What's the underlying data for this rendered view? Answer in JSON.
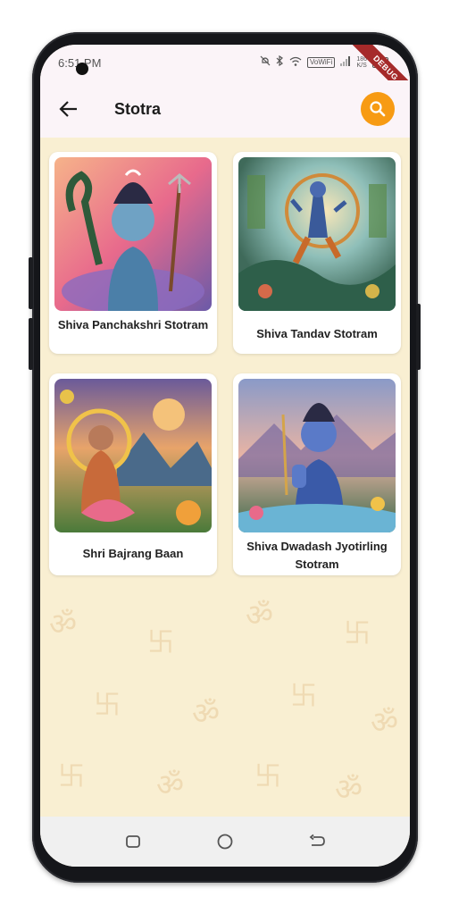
{
  "status_bar": {
    "time": "6:51 PM",
    "network_label": "VoWiFi",
    "speed": "186\nK/S",
    "debug_banner": "DEBUG"
  },
  "app_bar": {
    "back_icon": "arrow-left-icon",
    "title": "Stotra",
    "search_icon": "search-icon",
    "accent": "#f79b13"
  },
  "stotras": [
    {
      "title": "Shiva Panchakshri Stotram",
      "image": "shiva-with-trident-and-cobra"
    },
    {
      "title": "Shiva Tandav Stotram",
      "image": "nataraja-dancing-shiva"
    },
    {
      "title": "Shri Bajrang Baan",
      "image": "hanuman-seated-on-lotus"
    },
    {
      "title": "Shiva Dwadash Jyotirling Stotram",
      "image": "shiva-blessing-by-river"
    }
  ],
  "nav_bar": {
    "recents_icon": "square-icon",
    "home_icon": "circle-icon",
    "back_icon": "back-arrow-icon"
  },
  "colors": {
    "background": "#f9efd2",
    "card": "#ffffff",
    "appbar": "#fbf4f8"
  }
}
